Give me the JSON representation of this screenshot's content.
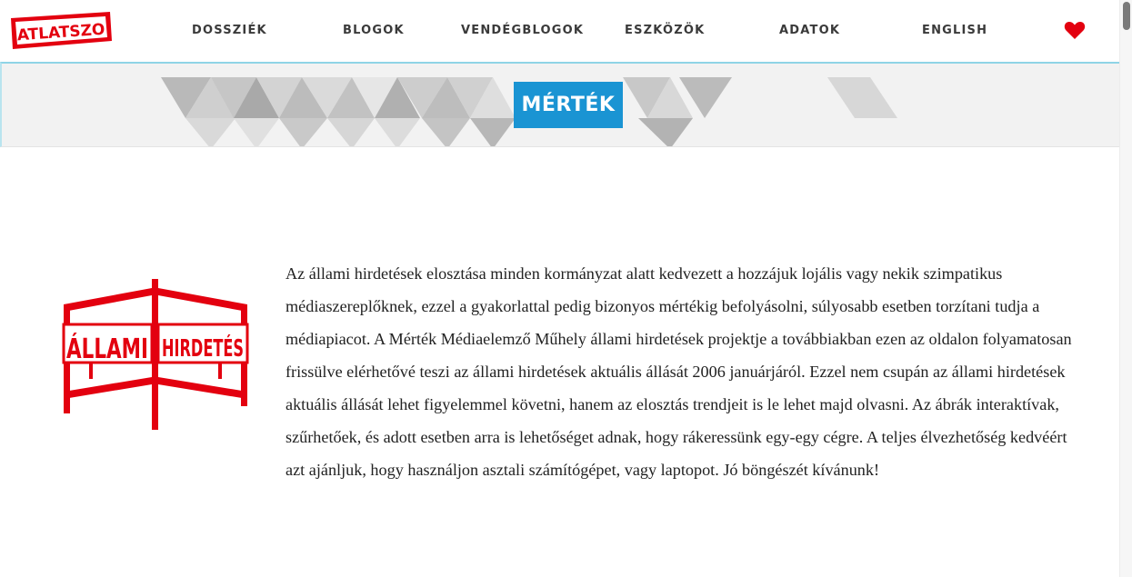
{
  "brand": {
    "logo_text": "ATLATSZO",
    "accent": "#e3000f"
  },
  "nav": {
    "items": [
      {
        "label": "DOSSZIÉK"
      },
      {
        "label": "BLOGOK"
      },
      {
        "label": "VENDÉGBLOGOK"
      },
      {
        "label": "ESZKÖZÖK"
      },
      {
        "label": "ADATOK"
      },
      {
        "label": "ENGLISH"
      }
    ],
    "heart_icon": "heart-icon"
  },
  "banner": {
    "title": "MÉRTÉK",
    "badge_color": "#1a94d3"
  },
  "emblem": {
    "left_text": "ÁLLAMI",
    "right_text": "HIRDETÉS"
  },
  "intro_text": "Az állami hirdetések elosztása minden kormányzat alatt kedvezett a hozzájuk lojális vagy nekik szimpatikus médiaszereplőknek, ezzel a gyakorlattal pedig bizonyos mértékig befolyásolni, súlyosabb esetben torzítani tudja a médiapiacot. A Mérték Médiaelemző Műhely állami hirdetések projektje a továbbiakban ezen az oldalon folyamatosan frissülve elérhetővé teszi az állami hirdetések aktuális állását 2006 januárjáról. Ezzel nem csupán az állami hirdetések aktuális állását lehet figyelemmel követni, hanem az elosztás trendjeit is le lehet majd olvasni. Az ábrák interaktívak, szűrhetőek, és adott esetben arra is lehetőséget adnak, hogy rákeressünk egy-egy cégre. A teljes élvezhetőség kedvéért azt ajánljuk, hogy használjon asztali számítógépet, vagy laptopot. Jó böngészét kívánunk!"
}
